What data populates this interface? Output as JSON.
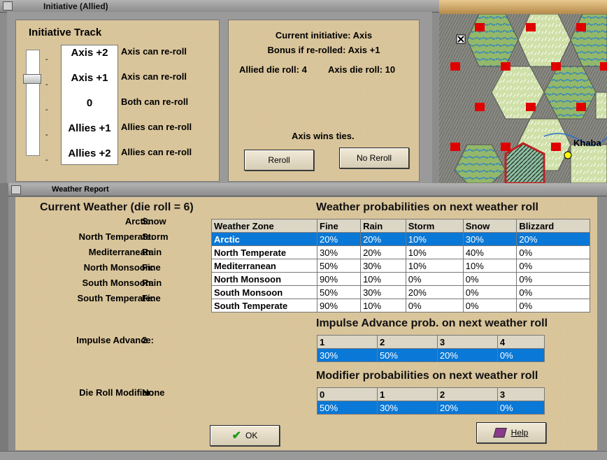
{
  "initiative_window": {
    "title": "Initiative (Allied)",
    "track_title": "Initiative Track",
    "track": [
      {
        "level": "Axis +2",
        "desc": "Axis can re-roll"
      },
      {
        "level": "Axis +1",
        "desc": "Axis can re-roll"
      },
      {
        "level": "0",
        "desc": "Both can re-roll"
      },
      {
        "level": "Allies +1",
        "desc": "Allies can re-roll"
      },
      {
        "level": "Allies +2",
        "desc": "Allies can re-roll"
      }
    ],
    "current_initiative": "Current initiative: Axis",
    "bonus": "Bonus if re-rolled: Axis +1",
    "allied_roll": "Allied die roll: 4",
    "axis_roll": "Axis die roll: 10",
    "ties": "Axis wins ties.",
    "reroll_label": "Reroll",
    "noreroll_label": "No Reroll"
  },
  "map": {
    "place_label": "Khaba"
  },
  "weather_window": {
    "title": "Weather Report",
    "current_weather_title": "Current Weather (die roll = 6)",
    "zones": [
      {
        "label": "Arctic:",
        "value": "Snow"
      },
      {
        "label": "North Temperate:",
        "value": "Storm"
      },
      {
        "label": "Mediterranean:",
        "value": "Rain"
      },
      {
        "label": "North Monsoon:",
        "value": "Fine"
      },
      {
        "label": "South Monsoon:",
        "value": "Rain"
      },
      {
        "label": "South Temperate:",
        "value": "Fine"
      }
    ],
    "impulse_label": "Impulse Advance:",
    "impulse_value": "2",
    "modifier_label": "Die Roll Modifier:",
    "modifier_value": "None",
    "prob_title": "Weather probabilities on next weather roll",
    "prob_table": {
      "headers": [
        "Weather Zone",
        "Fine",
        "Rain",
        "Storm",
        "Snow",
        "Blizzard"
      ],
      "rows": [
        [
          "Arctic",
          "20%",
          "20%",
          "10%",
          "30%",
          "20%"
        ],
        [
          "North Temperate",
          "30%",
          "20%",
          "10%",
          "40%",
          "0%"
        ],
        [
          "Mediterranean",
          "50%",
          "30%",
          "10%",
          "10%",
          "0%"
        ],
        [
          "North Monsoon",
          "90%",
          "10%",
          "0%",
          "0%",
          "0%"
        ],
        [
          "South Monsoon",
          "50%",
          "30%",
          "20%",
          "0%",
          "0%"
        ],
        [
          "South Temperate",
          "90%",
          "10%",
          "0%",
          "0%",
          "0%"
        ]
      ]
    },
    "impulse_title": "Impulse Advance prob. on next weather roll",
    "impulse_table": {
      "headers": [
        "1",
        "2",
        "3",
        "4"
      ],
      "values": [
        "30%",
        "50%",
        "20%",
        "0%"
      ]
    },
    "modifier_title": "Modifier probabilities on next weather roll",
    "modifier_table": {
      "headers": [
        "0",
        "1",
        "2",
        "3"
      ],
      "values": [
        "50%",
        "30%",
        "20%",
        "0%"
      ]
    },
    "ok_label": "OK",
    "help_label": "Help"
  }
}
